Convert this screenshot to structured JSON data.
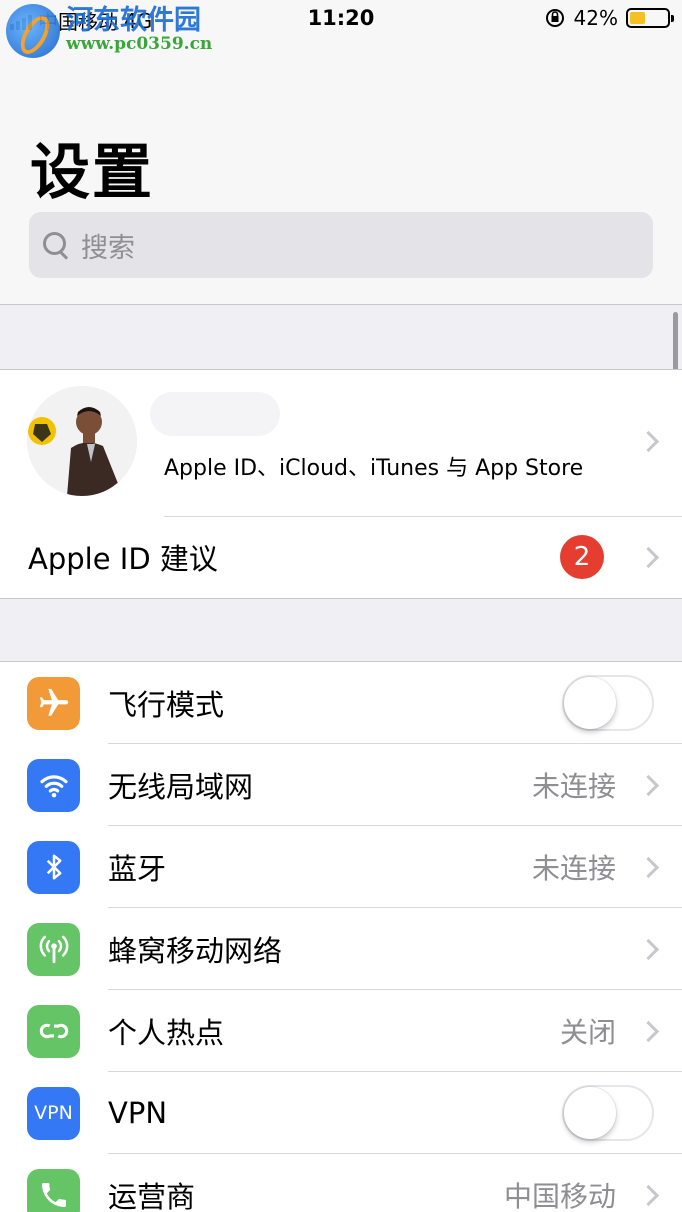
{
  "status_bar": {
    "carrier": "中国移动",
    "network": "4G",
    "time": "11:20",
    "battery_percent_text": "42%",
    "battery_level": 0.42
  },
  "watermark": {
    "name": "河东软件园",
    "url": "www.pc0359.cn"
  },
  "header": {
    "title": "设置",
    "search_placeholder": "搜索"
  },
  "profile": {
    "subtitle": "Apple ID、iCloud、iTunes 与 App Store",
    "suggestions_label": "Apple ID 建议",
    "suggestions_badge": "2"
  },
  "settings": [
    {
      "label": "飞行模式",
      "icon": "airplane-icon",
      "color": "#f19a37",
      "control": "toggle",
      "toggle_on": false
    },
    {
      "label": "无线局域网",
      "icon": "wifi-icon",
      "color": "#3478f6",
      "value": "未连接",
      "control": "chevron"
    },
    {
      "label": "蓝牙",
      "icon": "bluetooth-icon",
      "color": "#3478f6",
      "value": "未连接",
      "control": "chevron"
    },
    {
      "label": "蜂窝移动网络",
      "icon": "antenna-icon",
      "color": "#65c466",
      "control": "chevron"
    },
    {
      "label": "个人热点",
      "icon": "hotspot-icon",
      "color": "#65c466",
      "value": "关闭",
      "control": "chevron"
    },
    {
      "label": "VPN",
      "icon": "vpn-icon",
      "icon_text": "VPN",
      "color": "#3478f6",
      "control": "toggle",
      "toggle_on": false
    },
    {
      "label": "运营商",
      "icon": "phone-icon",
      "color": "#65c466",
      "value": "中国移动",
      "control": "chevron"
    }
  ]
}
